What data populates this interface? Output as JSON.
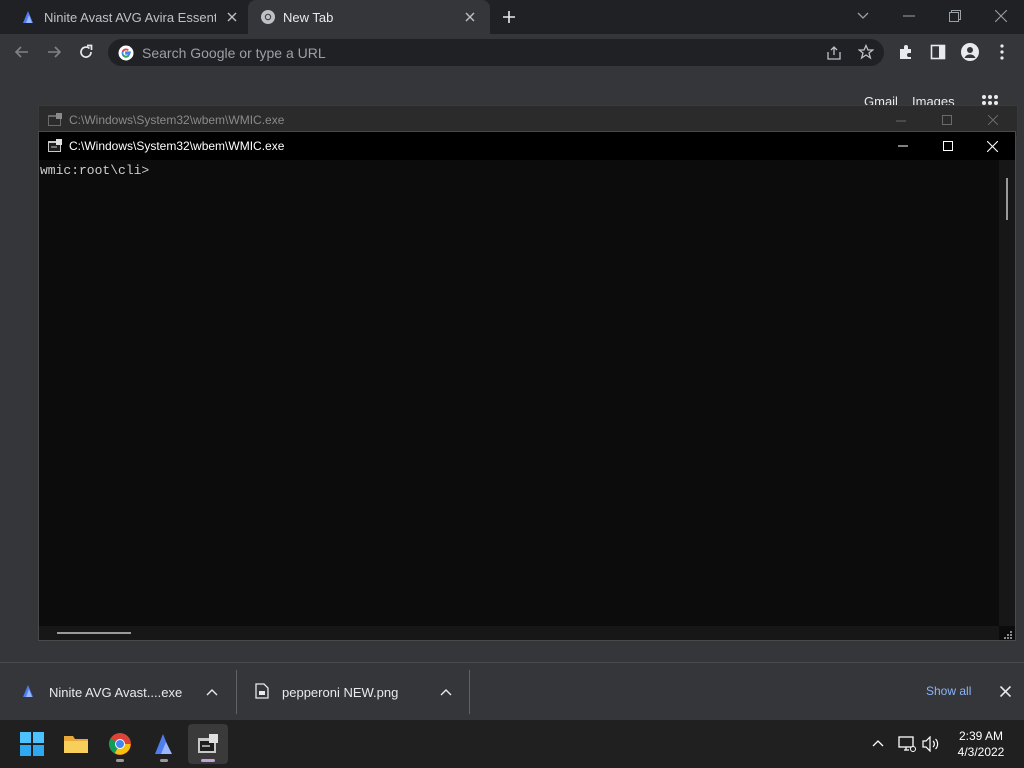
{
  "browser": {
    "tabs": [
      {
        "label": "Ninite Avast AVG Avira Essentials",
        "icon": "ninite-icon",
        "active": false
      },
      {
        "label": "New Tab",
        "icon": "chrome-icon",
        "active": true
      }
    ],
    "omnibox": {
      "placeholder": "Search Google or type a URL",
      "value": ""
    }
  },
  "ntp": {
    "gmail": "Gmail",
    "images": "Images"
  },
  "wmic_back": {
    "title": "C:\\Windows\\System32\\wbem\\WMIC.exe"
  },
  "wmic": {
    "title": "C:\\Windows\\System32\\wbem\\WMIC.exe",
    "console_text": "wmic:root\\cli>"
  },
  "downloads": {
    "items": [
      {
        "label": "Ninite AVG Avast....exe",
        "icon": "ninite-icon"
      },
      {
        "label": "pepperoni NEW.png",
        "icon": "image-file-icon"
      }
    ],
    "show_all": "Show all"
  },
  "taskbar": {
    "apps": [
      "windows-start-icon",
      "file-explorer-icon",
      "chrome-icon",
      "ninite-icon",
      "wmic-icon"
    ],
    "time": "2:39 AM",
    "date": "4/3/2022"
  },
  "colors": {
    "accent_blue": "#8ab4f8",
    "console_bg": "#0c0c0c",
    "taskbar_bg": "#202020"
  }
}
